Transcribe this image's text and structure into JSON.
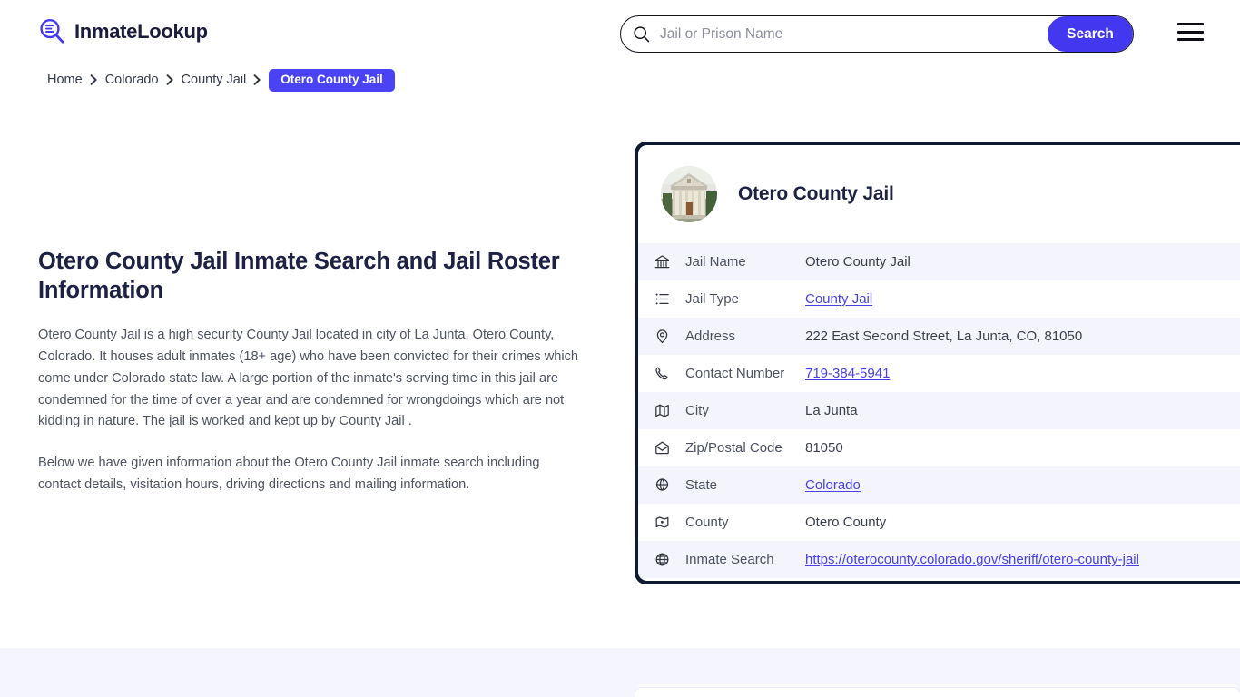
{
  "brand": {
    "name": "InmateLookup",
    "icon": "magnifier-list-icon"
  },
  "search": {
    "placeholder": "Jail or Prison Name",
    "value": "",
    "button_label": "Search",
    "icon": "search-icon"
  },
  "menu": {
    "icon": "hamburger-menu-icon"
  },
  "breadcrumb": {
    "items": [
      {
        "label": "Home",
        "current": false
      },
      {
        "label": "Colorado",
        "current": false
      },
      {
        "label": "County Jail",
        "current": false
      },
      {
        "label": "Otero County Jail",
        "current": true
      }
    ]
  },
  "main": {
    "title": "Otero County Jail Inmate Search and Jail Roster Information",
    "paragraphs": [
      "Otero County Jail is a high security County Jail located in city of La Junta, Otero County, Colorado. It houses adult inmates (18+ age) who have been convicted for their crimes which come under Colorado state law. A large portion of the inmate's serving time in this jail are condemned for the time of over a year and are condemned for wrongdoings which are not kidding in nature. The jail is worked and kept up by County Jail .",
      "Below we have given information about the Otero County Jail inmate search including contact details, visitation hours, driving directions and mailing information."
    ]
  },
  "card": {
    "avatar_alt": "courthouse-photo",
    "title": "Otero County Jail",
    "rows": [
      {
        "icon": "bank-icon",
        "label": "Jail Name",
        "value": "Otero County Jail",
        "link": false
      },
      {
        "icon": "list-icon",
        "label": "Jail Type",
        "value": "County Jail",
        "link": true
      },
      {
        "icon": "location-pin-icon",
        "label": "Address",
        "value": "222 East Second Street, La Junta, CO, 81050",
        "link": false
      },
      {
        "icon": "phone-icon",
        "label": "Contact Number",
        "value": "719-384-5941",
        "link": true,
        "wide": true
      },
      {
        "icon": "map-icon",
        "label": "City",
        "value": "La Junta",
        "link": false
      },
      {
        "icon": "envelope-icon",
        "label": "Zip/Postal Code",
        "value": "81050",
        "link": false,
        "wide": true
      },
      {
        "icon": "globe-stand-icon",
        "label": "State",
        "value": "Colorado",
        "link": true
      },
      {
        "icon": "county-map-icon",
        "label": "County",
        "value": "Otero County",
        "link": false
      },
      {
        "icon": "globe-icon",
        "label": "Inmate Search",
        "value": "https://oterocounty.colorado.gov/sheriff/otero-county-jail",
        "link": true
      }
    ]
  },
  "colors": {
    "accent": "#4338f0",
    "badge": "#4a43f5",
    "card_border": "#111a33",
    "row_alt": "#f4f5fc",
    "link": "#4840e8",
    "heading": "#1d2144",
    "band": "#f5f5fd"
  }
}
